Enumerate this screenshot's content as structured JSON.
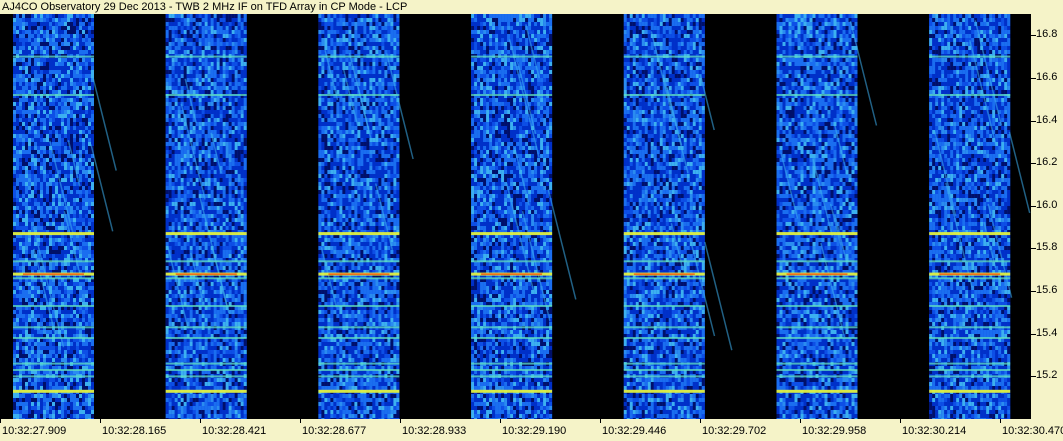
{
  "title": "AJ4CO Observatory 29 Dec 2013 - TWB 2 MHz IF on TFD Array in CP Mode - LCP",
  "chart_data": {
    "type": "heatmap",
    "title": "AJ4CO Observatory 29 Dec 2013 - TWB 2 MHz IF on TFD Array in CP Mode - LCP",
    "xlabel": "",
    "ylabel": "",
    "x_tick_labels": [
      "10:32:27.909",
      "10:32:28.165",
      "10:32:28.421",
      "10:32:28.677",
      "10:32:28.933",
      "10:32:29.190",
      "10:32:29.446",
      "10:32:29.702",
      "10:32:29.958",
      "10:32:30.214",
      "10:32:30.470"
    ],
    "y_ticks": [
      15.2,
      15.4,
      15.6,
      15.8,
      16.0,
      16.2,
      16.4,
      16.6,
      16.8
    ],
    "y_tick_labels": [
      "15.2",
      "15.4",
      "15.6",
      "15.8",
      "16.0",
      "16.2",
      "16.4",
      "16.6",
      "16.8"
    ],
    "ylim": [
      15.0,
      16.9
    ],
    "y_axis_side": "right",
    "data_blocks": 7,
    "gaps": "black",
    "colormap": [
      "#00106a",
      "#0030c8",
      "#1a6ef0",
      "#3cb0f0",
      "#60e0c0",
      "#e0f040",
      "#ff2000",
      "#ffffff"
    ],
    "rfi_lines_freq": [
      15.13,
      15.2,
      15.23,
      15.26,
      15.38,
      15.43,
      15.53,
      15.66,
      15.68,
      15.74,
      15.87,
      16.52,
      16.7
    ]
  }
}
